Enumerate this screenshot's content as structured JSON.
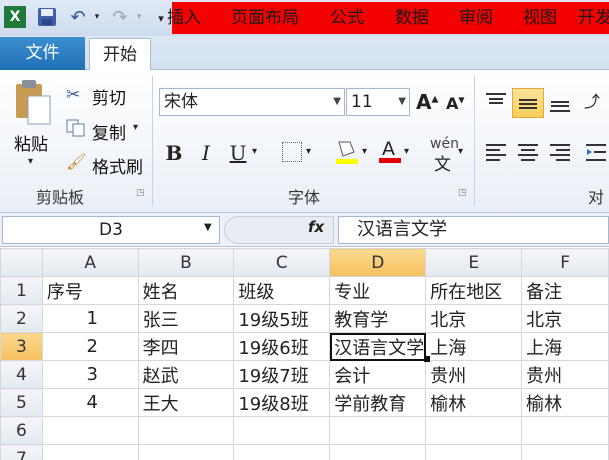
{
  "title_bar": {
    "excel_icon": "excel-icon",
    "save_icon": "save-icon",
    "undo_icon": "undo-icon",
    "redo_icon": "redo-icon",
    "customize_icon": "dropdown-icon"
  },
  "tabs": [
    {
      "label": "文件"
    },
    {
      "label": "开始"
    },
    {
      "label": "插入"
    },
    {
      "label": "页面布局"
    },
    {
      "label": "公式"
    },
    {
      "label": "数据"
    },
    {
      "label": "审阅"
    },
    {
      "label": "视图"
    },
    {
      "label": "开发"
    }
  ],
  "ribbon": {
    "clipboard": {
      "paste": "粘贴",
      "cut": "剪切",
      "copy": "复制",
      "format_painter": "格式刷",
      "group_label": "剪贴板"
    },
    "font": {
      "font_name": "宋体",
      "font_size": "11",
      "bold": "B",
      "italic": "I",
      "underline": "U",
      "wen": "wén",
      "group_label": "字体"
    },
    "align_group_label": "对齐"
  },
  "formula_bar": {
    "name_box": "D3",
    "fx": "fx",
    "content": "汉语言文学"
  },
  "grid": {
    "columns": [
      "A",
      "B",
      "C",
      "D",
      "E",
      "F"
    ],
    "rows": [
      {
        "n": "1",
        "cells": [
          "序号",
          "姓名",
          "班级",
          "专业",
          "所在地区",
          "备注"
        ]
      },
      {
        "n": "2",
        "cells": [
          "1",
          "张三",
          "19级5班",
          "教育学",
          "北京",
          "北京"
        ]
      },
      {
        "n": "3",
        "cells": [
          "2",
          "李四",
          "19级6班",
          "汉语言文学",
          "上海",
          "上海"
        ]
      },
      {
        "n": "4",
        "cells": [
          "3",
          "赵武",
          "19级7班",
          "会计",
          "贵州",
          "贵州"
        ]
      },
      {
        "n": "5",
        "cells": [
          "4",
          "王大",
          "19级8班",
          "学前教育",
          "榆林",
          "榆林"
        ]
      },
      {
        "n": "6",
        "cells": [
          "",
          "",
          "",
          "",
          "",
          ""
        ]
      },
      {
        "n": "7",
        "cells": [
          "",
          "",
          "",
          "",
          "",
          ""
        ]
      }
    ]
  }
}
